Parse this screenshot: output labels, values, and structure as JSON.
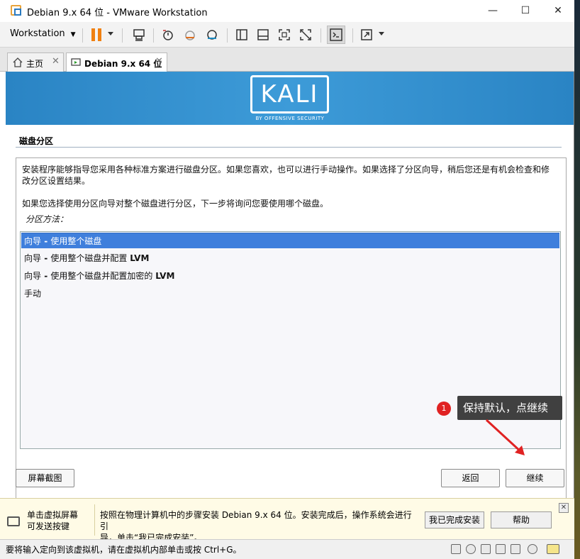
{
  "window": {
    "title": "Debian 9.x 64 位 - VMware Workstation",
    "minimize": "—",
    "maximize": "☐",
    "close": "✕"
  },
  "toolbar": {
    "menu_label": "Workstation",
    "menu_caret": "▼",
    "icons": [
      "pause-icon",
      "send-ctrl-alt-del-icon",
      "snapshot-icon",
      "revert-snapshot-icon",
      "snapshot-manager-icon",
      "sidebar-toggle-icon",
      "thumbnail-bar-icon",
      "full-screen-icon",
      "unity-icon",
      "console-view-icon",
      "stretch-icon"
    ]
  },
  "tabs": [
    {
      "label": "主页",
      "icon": "home-icon",
      "active": false
    },
    {
      "label": "Debian 9.x 64 位",
      "icon": "vm-icon",
      "active": true
    }
  ],
  "tab_close": "✕",
  "installer": {
    "brand": "KALI",
    "brand_sub": "BY OFFENSIVE SECURITY",
    "section_title": "磁盘分区",
    "para1_line1": "安装程序能够指导您采用各种标准方案进行磁盘分区。如果您喜欢，也可以进行手动操作。如果选择了分区向导，稍后您还是有机会检查和修",
    "para1_line2": "改分区设置结果。",
    "para2": "如果您选择使用分区向导对整个磁盘进行分区，下一步将询问您要使用哪个磁盘。",
    "method_label": "分区方法：",
    "options": [
      {
        "prefix": "向导",
        "dash": " - ",
        "text": "使用整个磁盘",
        "suffix": ""
      },
      {
        "prefix": "向导",
        "dash": " - ",
        "text": "使用整个磁盘并配置 ",
        "suffix": "LVM"
      },
      {
        "prefix": "向导",
        "dash": " - ",
        "text": "使用整个磁盘并配置加密的 ",
        "suffix": "LVM"
      },
      {
        "prefix": "手动",
        "dash": "",
        "text": "",
        "suffix": ""
      }
    ],
    "selected_index": 0,
    "screenshot_button": "屏幕截图",
    "back_button": "返回",
    "continue_button": "继续"
  },
  "annotation": {
    "badge": "1",
    "text": "保持默认，点继续"
  },
  "hint": {
    "left_line1": "单击虚拟屏幕",
    "left_line2": "可发送按键",
    "text_line1": "按照在物理计算机中的步骤安装 Debian 9.x 64 位。安装完成后，操作系统会进行引",
    "text_line2": "导，单击“我已完成安装”。",
    "done_button": "我已完成安装",
    "help_button": "帮助",
    "close": "✕"
  },
  "status": {
    "text": "要将输入定向到该虚拟机，请在虚拟机内部单击或按 Ctrl+G。",
    "devices": [
      "hard-disk-icon",
      "cd-rom-icon",
      "network-icon",
      "usb-icon",
      "sound-icon",
      "display-icon"
    ]
  },
  "colors": {
    "banner": "#3d9bd8",
    "selection": "#3f7fdc",
    "pause": "#f08010",
    "badge": "#e02222"
  }
}
